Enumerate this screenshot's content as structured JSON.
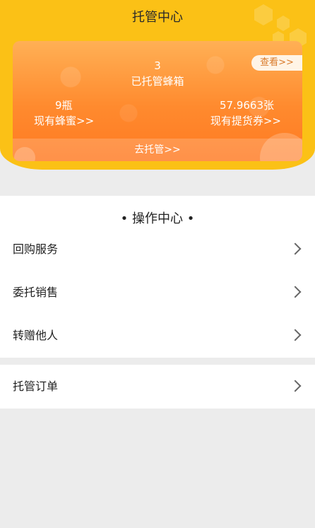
{
  "header": {
    "title": "托管中心"
  },
  "card": {
    "view_button": "查看>>",
    "box_count": "3",
    "box_label": "已托管蜂箱",
    "honey_value": "9瓶",
    "honey_link": "现有蜂蜜>>",
    "voucher_value": "57.9663张",
    "voucher_link": "现有提货券>>",
    "go_host": "去托管>>"
  },
  "operations": {
    "title": "• 操作中心 •",
    "items": [
      {
        "label": "回购服务"
      },
      {
        "label": "委托销售"
      },
      {
        "label": "转赠他人"
      }
    ]
  },
  "orders": {
    "label": "托管订单"
  },
  "colors": {
    "header_bg": "#fbc116",
    "card_gradient_top": "#ffb055",
    "card_gradient_bottom": "#ff7a22",
    "page_bg": "#ececec"
  }
}
